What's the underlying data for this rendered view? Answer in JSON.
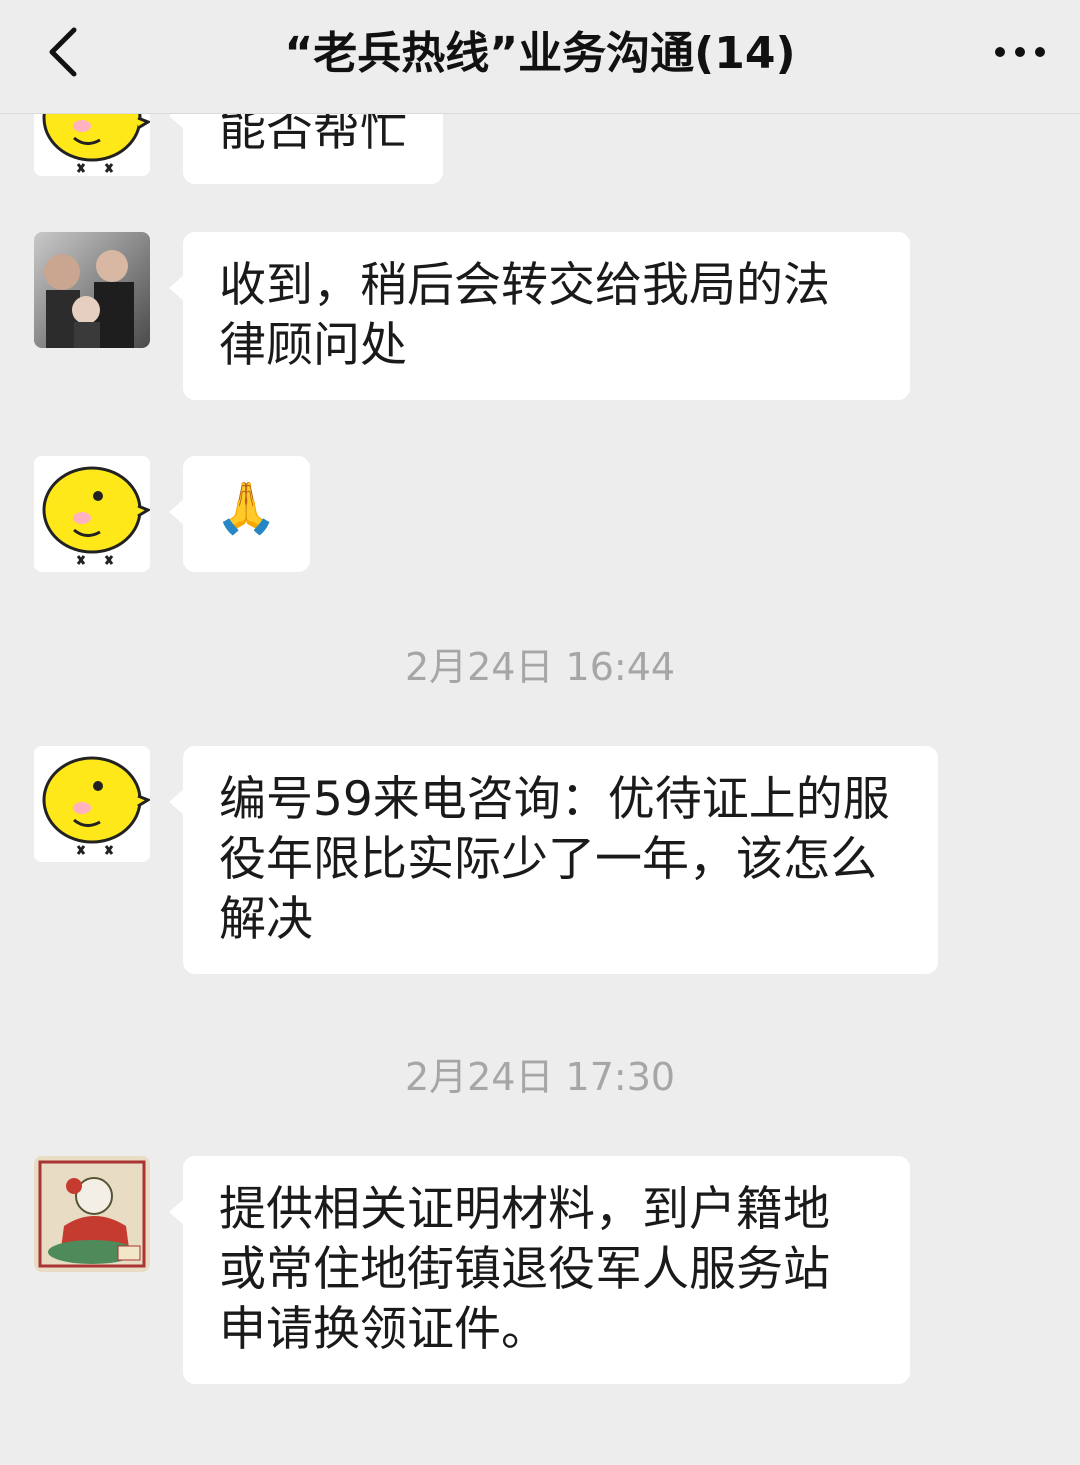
{
  "header": {
    "title": "“老兵热线”业务沟通(14)",
    "back_icon": "chevron-left-icon",
    "more_icon": "more-dots-icon"
  },
  "messages": [
    {
      "type": "text",
      "avatar": "chick-avatar",
      "text": "能否帮忙"
    },
    {
      "type": "text",
      "avatar": "photo-avatar",
      "text": "收到，稍后会转交给我局的法律顾问处"
    },
    {
      "type": "emoji",
      "avatar": "chick-avatar",
      "text": "🙏"
    },
    {
      "type": "time",
      "text": "2月24日 16:44"
    },
    {
      "type": "text",
      "avatar": "chick-avatar",
      "text": "编号59来电咨询：优待证上的服役年限比实际少了一年，该怎么解决"
    },
    {
      "type": "time",
      "text": "2月24日 17:30"
    },
    {
      "type": "text",
      "avatar": "illustration-avatar",
      "text": "提供相关证明材料，到户籍地或常住地街镇退役军人服务站申请换领证件。"
    }
  ]
}
